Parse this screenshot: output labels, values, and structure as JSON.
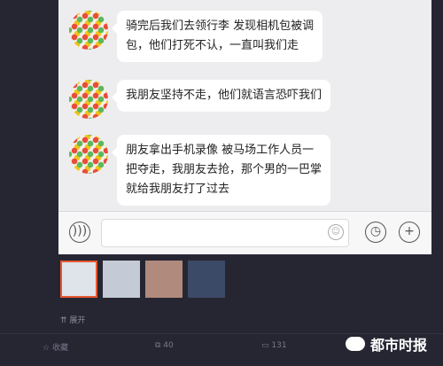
{
  "chat": {
    "messages": [
      {
        "text_line1": "骑完后我们去领行李  发现相机包被调",
        "text_line2": "包，他们打死不认，一直叫我们走"
      },
      {
        "text_line1": "我朋友坚持不走，他们就语言恐吓我们"
      },
      {
        "text_line1": "朋友拿出手机录像  被马场工作人员一",
        "text_line2": "把夺走，我朋友去抢，那个男的一巴掌",
        "text_line3": "就给我朋友打了过去"
      }
    ]
  },
  "post": {
    "expand_label": "展开",
    "actions": {
      "favorite": "收藏",
      "repost_count": "40",
      "comment_count": "131"
    }
  },
  "watermark": {
    "text": "都市时报"
  },
  "icons": [
    "voice-icon",
    "emoji-icon",
    "clock-icon",
    "plus-icon",
    "star-icon",
    "repost-icon",
    "comment-icon",
    "wechat-icon"
  ]
}
